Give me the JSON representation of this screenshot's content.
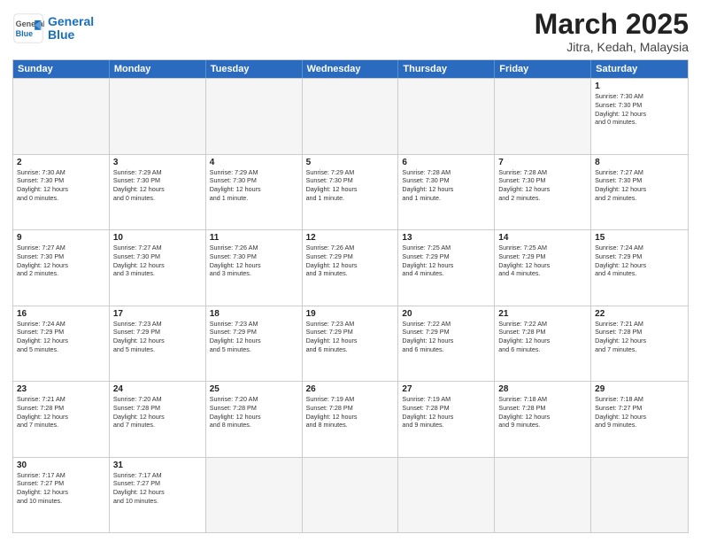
{
  "header": {
    "logo_general": "General",
    "logo_blue": "Blue",
    "month": "March 2025",
    "location": "Jitra, Kedah, Malaysia"
  },
  "days": [
    "Sunday",
    "Monday",
    "Tuesday",
    "Wednesday",
    "Thursday",
    "Friday",
    "Saturday"
  ],
  "rows": [
    [
      {
        "num": "",
        "empty": true,
        "info": ""
      },
      {
        "num": "",
        "empty": true,
        "info": ""
      },
      {
        "num": "",
        "empty": true,
        "info": ""
      },
      {
        "num": "",
        "empty": true,
        "info": ""
      },
      {
        "num": "",
        "empty": true,
        "info": ""
      },
      {
        "num": "",
        "empty": true,
        "info": ""
      },
      {
        "num": "1",
        "empty": false,
        "info": "Sunrise: 7:30 AM\nSunset: 7:30 PM\nDaylight: 12 hours\nand 0 minutes."
      }
    ],
    [
      {
        "num": "2",
        "empty": false,
        "info": "Sunrise: 7:30 AM\nSunset: 7:30 PM\nDaylight: 12 hours\nand 0 minutes."
      },
      {
        "num": "3",
        "empty": false,
        "info": "Sunrise: 7:29 AM\nSunset: 7:30 PM\nDaylight: 12 hours\nand 0 minutes."
      },
      {
        "num": "4",
        "empty": false,
        "info": "Sunrise: 7:29 AM\nSunset: 7:30 PM\nDaylight: 12 hours\nand 1 minute."
      },
      {
        "num": "5",
        "empty": false,
        "info": "Sunrise: 7:29 AM\nSunset: 7:30 PM\nDaylight: 12 hours\nand 1 minute."
      },
      {
        "num": "6",
        "empty": false,
        "info": "Sunrise: 7:28 AM\nSunset: 7:30 PM\nDaylight: 12 hours\nand 1 minute."
      },
      {
        "num": "7",
        "empty": false,
        "info": "Sunrise: 7:28 AM\nSunset: 7:30 PM\nDaylight: 12 hours\nand 2 minutes."
      },
      {
        "num": "8",
        "empty": false,
        "info": "Sunrise: 7:27 AM\nSunset: 7:30 PM\nDaylight: 12 hours\nand 2 minutes."
      }
    ],
    [
      {
        "num": "9",
        "empty": false,
        "info": "Sunrise: 7:27 AM\nSunset: 7:30 PM\nDaylight: 12 hours\nand 2 minutes."
      },
      {
        "num": "10",
        "empty": false,
        "info": "Sunrise: 7:27 AM\nSunset: 7:30 PM\nDaylight: 12 hours\nand 3 minutes."
      },
      {
        "num": "11",
        "empty": false,
        "info": "Sunrise: 7:26 AM\nSunset: 7:30 PM\nDaylight: 12 hours\nand 3 minutes."
      },
      {
        "num": "12",
        "empty": false,
        "info": "Sunrise: 7:26 AM\nSunset: 7:29 PM\nDaylight: 12 hours\nand 3 minutes."
      },
      {
        "num": "13",
        "empty": false,
        "info": "Sunrise: 7:25 AM\nSunset: 7:29 PM\nDaylight: 12 hours\nand 4 minutes."
      },
      {
        "num": "14",
        "empty": false,
        "info": "Sunrise: 7:25 AM\nSunset: 7:29 PM\nDaylight: 12 hours\nand 4 minutes."
      },
      {
        "num": "15",
        "empty": false,
        "info": "Sunrise: 7:24 AM\nSunset: 7:29 PM\nDaylight: 12 hours\nand 4 minutes."
      }
    ],
    [
      {
        "num": "16",
        "empty": false,
        "info": "Sunrise: 7:24 AM\nSunset: 7:29 PM\nDaylight: 12 hours\nand 5 minutes."
      },
      {
        "num": "17",
        "empty": false,
        "info": "Sunrise: 7:23 AM\nSunset: 7:29 PM\nDaylight: 12 hours\nand 5 minutes."
      },
      {
        "num": "18",
        "empty": false,
        "info": "Sunrise: 7:23 AM\nSunset: 7:29 PM\nDaylight: 12 hours\nand 5 minutes."
      },
      {
        "num": "19",
        "empty": false,
        "info": "Sunrise: 7:23 AM\nSunset: 7:29 PM\nDaylight: 12 hours\nand 6 minutes."
      },
      {
        "num": "20",
        "empty": false,
        "info": "Sunrise: 7:22 AM\nSunset: 7:29 PM\nDaylight: 12 hours\nand 6 minutes."
      },
      {
        "num": "21",
        "empty": false,
        "info": "Sunrise: 7:22 AM\nSunset: 7:28 PM\nDaylight: 12 hours\nand 6 minutes."
      },
      {
        "num": "22",
        "empty": false,
        "info": "Sunrise: 7:21 AM\nSunset: 7:28 PM\nDaylight: 12 hours\nand 7 minutes."
      }
    ],
    [
      {
        "num": "23",
        "empty": false,
        "info": "Sunrise: 7:21 AM\nSunset: 7:28 PM\nDaylight: 12 hours\nand 7 minutes."
      },
      {
        "num": "24",
        "empty": false,
        "info": "Sunrise: 7:20 AM\nSunset: 7:28 PM\nDaylight: 12 hours\nand 7 minutes."
      },
      {
        "num": "25",
        "empty": false,
        "info": "Sunrise: 7:20 AM\nSunset: 7:28 PM\nDaylight: 12 hours\nand 8 minutes."
      },
      {
        "num": "26",
        "empty": false,
        "info": "Sunrise: 7:19 AM\nSunset: 7:28 PM\nDaylight: 12 hours\nand 8 minutes."
      },
      {
        "num": "27",
        "empty": false,
        "info": "Sunrise: 7:19 AM\nSunset: 7:28 PM\nDaylight: 12 hours\nand 9 minutes."
      },
      {
        "num": "28",
        "empty": false,
        "info": "Sunrise: 7:18 AM\nSunset: 7:28 PM\nDaylight: 12 hours\nand 9 minutes."
      },
      {
        "num": "29",
        "empty": false,
        "info": "Sunrise: 7:18 AM\nSunset: 7:27 PM\nDaylight: 12 hours\nand 9 minutes."
      }
    ],
    [
      {
        "num": "30",
        "empty": false,
        "info": "Sunrise: 7:17 AM\nSunset: 7:27 PM\nDaylight: 12 hours\nand 10 minutes."
      },
      {
        "num": "31",
        "empty": false,
        "info": "Sunrise: 7:17 AM\nSunset: 7:27 PM\nDaylight: 12 hours\nand 10 minutes."
      },
      {
        "num": "",
        "empty": true,
        "info": ""
      },
      {
        "num": "",
        "empty": true,
        "info": ""
      },
      {
        "num": "",
        "empty": true,
        "info": ""
      },
      {
        "num": "",
        "empty": true,
        "info": ""
      },
      {
        "num": "",
        "empty": true,
        "info": ""
      }
    ]
  ]
}
